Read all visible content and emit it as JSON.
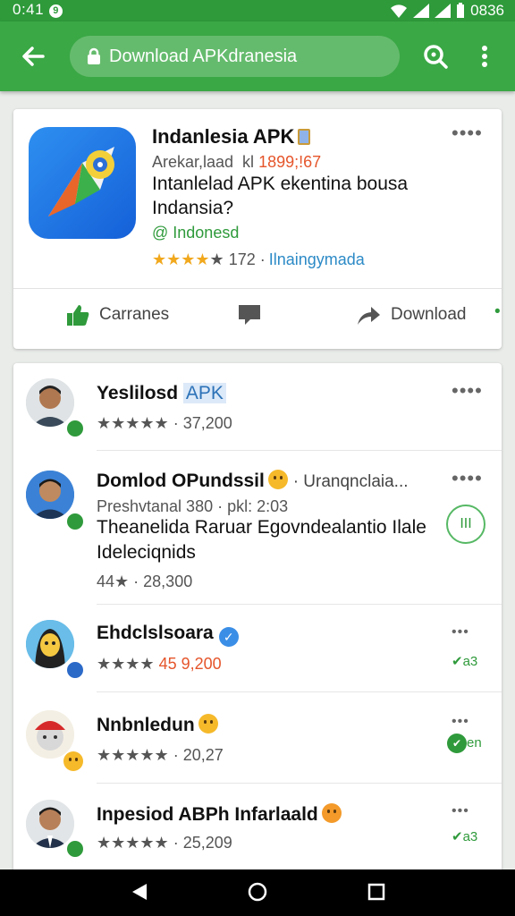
{
  "status_bar": {
    "time": "0:41",
    "notif": "9",
    "battery": "0836"
  },
  "toolbar": {
    "url": "Download APKdranesia"
  },
  "featured": {
    "title": "Indanlesia APK",
    "subtitle": "Arekar,laad  kl",
    "subtitle_highlight": "1899;!67",
    "description": "Intanlelad APK ekentina bousa Indansia?",
    "developer": "@ Indonesd",
    "rating_value": "172",
    "rating_link": "Ilnaingymada",
    "actions": [
      {
        "label": "Carranes"
      },
      {
        "label": "Download"
      }
    ]
  },
  "list": [
    {
      "name": "Yeslilosd",
      "tag": "APK",
      "rating": "37,200"
    },
    {
      "name": "Domlod OPundssil",
      "extra": "· Uranqnclaia...",
      "meta": "Preshvtanal 380 · pkl: 2:03",
      "desc": "Theanelida Raruar Egovndealantio Ilale Ideleciqnids",
      "rating": "44★ · 28,300",
      "side": "III"
    },
    {
      "name": "Ehdclslsoara",
      "rating_red": "45",
      "rating": "9,200",
      "side": "a3"
    },
    {
      "name": "Nnbnledun",
      "rating": "20,27",
      "side": "en"
    },
    {
      "name": "Inpesiod ABPh Infarlaald",
      "rating": "25,209",
      "side": "a3"
    }
  ]
}
